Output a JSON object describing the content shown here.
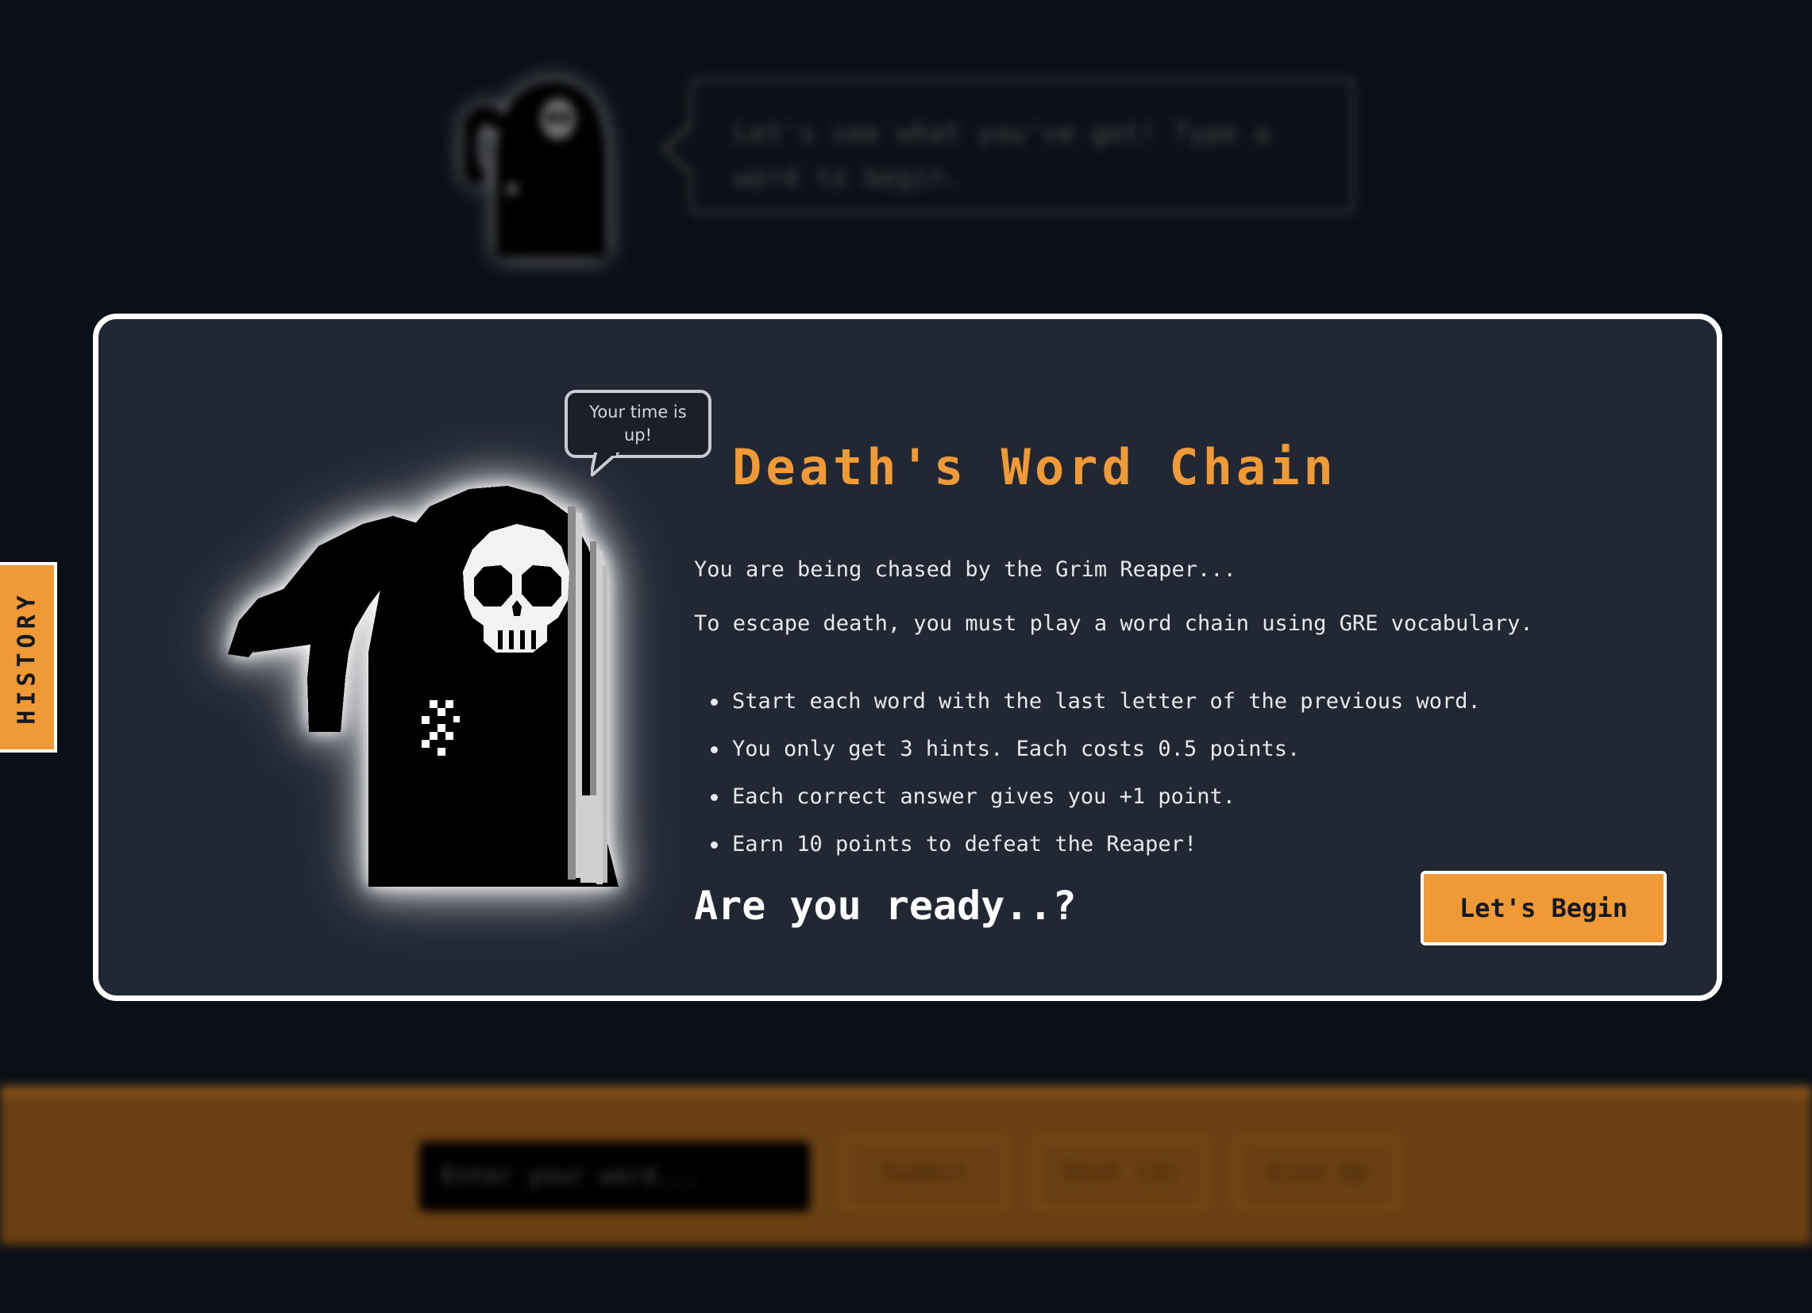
{
  "background": {
    "bubble_text": "Let's see what you've got! Type a word to begin.",
    "input_placeholder": "Enter your word...",
    "submit_label": "Submit",
    "hint_label": "Hint (3)",
    "giveup_label": "Give Up"
  },
  "sidebar": {
    "history_label": "HISTORY"
  },
  "modal": {
    "speech": "Your time is up!",
    "title": "Death's Word Chain",
    "intro_1": "You are being chased by the Grim Reaper...",
    "intro_2": "To escape death, you must play a word chain using GRE vocabulary.",
    "rules": [
      "Start each word with the last letter of the previous word.",
      "You only get 3 hints. Each costs 0.5 points.",
      "Each correct answer gives you +1 point.",
      "Earn 10 points to defeat the Reaper!"
    ],
    "ready": "Are you ready..?",
    "begin_label": "Let's Begin"
  },
  "colors": {
    "accent": "#f09a37",
    "modal_bg": "#212733",
    "page_bg": "#0b0f17"
  }
}
